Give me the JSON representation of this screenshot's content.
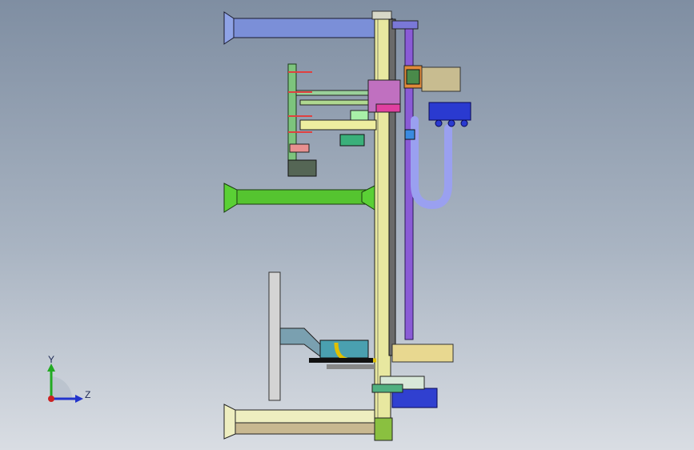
{
  "view": {
    "background_top": "#7f8ea2",
    "background_bottom": "#d9dde3"
  },
  "triad": {
    "y_label": "Y",
    "z_label": "Z",
    "y_color": "#22aa22",
    "z_color": "#2233cc",
    "x_color": "#cc2222"
  }
}
